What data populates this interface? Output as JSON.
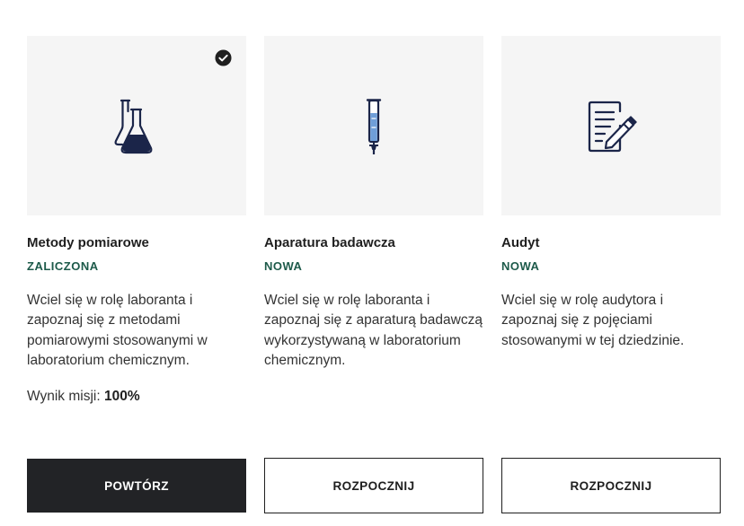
{
  "colors": {
    "thumb_background": "#f5f5f5",
    "status_color": "#1d5a4a",
    "icon_navy": "#1b2549",
    "icon_blue": "#6f9ed8",
    "dark_button": "#222326"
  },
  "missions": [
    {
      "title": "Metody pomiarowe",
      "status": "ZALICZONA",
      "description": "Wciel się w rolę laboranta i zapoznaj się z metodami pomiarowymi stosowanymi w laboratorium chemicznym.",
      "result_label": "Wynik misji:",
      "result_value": "100%",
      "button_label": "POWTÓRZ",
      "icon": "flask-icon",
      "completed_badge_icon": "check-badge-icon"
    },
    {
      "title": "Aparatura badawcza",
      "status": "NOWA",
      "description": "Wciel się w rolę laboranta i zapoznaj się z aparaturą badawczą wykorzystywaną w laboratorium chemicznym.",
      "button_label": "ROZPOCZNIJ",
      "icon": "burette-icon"
    },
    {
      "title": "Audyt",
      "status": "NOWA",
      "description": "Wciel się w rolę audytora i zapoznaj się z pojęciami stosowanymi w tej dziedzinie.",
      "button_label": "ROZPOCZNIJ",
      "icon": "document-pen-icon"
    }
  ]
}
